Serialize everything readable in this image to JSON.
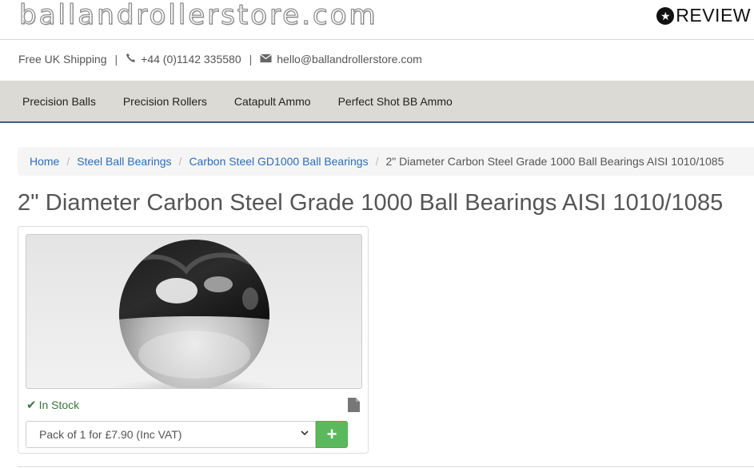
{
  "header": {
    "logo_text": "ballandrollerstore.com",
    "review_badge_text": "REVIEW",
    "review_icon": "star-circle-icon"
  },
  "contact": {
    "shipping": "Free UK Shipping",
    "phone_icon": "phone-icon",
    "phone": "+44 (0)1142 335580",
    "email_icon": "envelope-icon",
    "email": "hello@ballandrollerstore.com"
  },
  "nav": {
    "items": [
      {
        "label": "Precision Balls"
      },
      {
        "label": "Precision Rollers"
      },
      {
        "label": "Catapult Ammo"
      },
      {
        "label": "Perfect Shot BB Ammo"
      }
    ]
  },
  "breadcrumb": {
    "items": [
      {
        "label": "Home"
      },
      {
        "label": "Steel Ball Bearings"
      },
      {
        "label": "Carbon Steel GD1000 Ball Bearings"
      }
    ],
    "current": "2\" Diameter Carbon Steel Grade 1000 Ball Bearings AISI 1010/1085"
  },
  "product": {
    "title": "2\" Diameter Carbon Steel Grade 1000 Ball Bearings AISI 1010/1085",
    "stock_status": "In Stock",
    "pack_option": "Pack of 1 for £7.90 (Inc VAT)",
    "add_button_label": "+"
  },
  "colors": {
    "link": "#2a6ebb",
    "nav_bg": "#dcdad4",
    "nav_border": "#3d5d8a",
    "in_stock": "#3c763d",
    "add_button": "#5cb85c"
  }
}
